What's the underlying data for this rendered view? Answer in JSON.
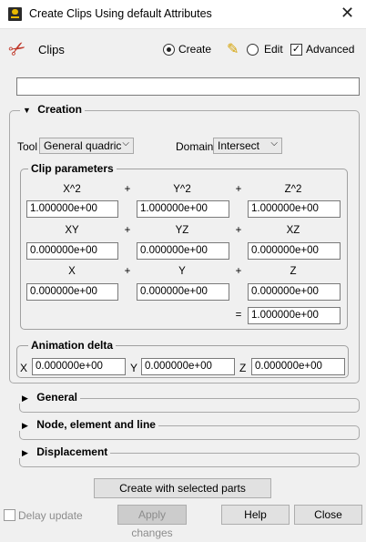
{
  "window": {
    "title": "Create Clips Using default Attributes"
  },
  "header": {
    "section_label": "Clips",
    "mode_create": "Create",
    "mode_edit": "Edit",
    "advanced": "Advanced",
    "selected_mode": "Create",
    "advanced_checked": true
  },
  "filter": {
    "value": ""
  },
  "creation": {
    "title": "Creation",
    "tool_label": "Tool",
    "tool_value": "General quadric",
    "domain_label": "Domain",
    "domain_value": "Intersect",
    "clip_parameters": {
      "title": "Clip parameters",
      "plus": "+",
      "equals": "=",
      "row1": {
        "labels": [
          "X^2",
          "Y^2",
          "Z^2"
        ],
        "values": [
          "1.000000e+00",
          "1.000000e+00",
          "1.000000e+00"
        ]
      },
      "row2": {
        "labels": [
          "XY",
          "YZ",
          "XZ"
        ],
        "values": [
          "0.000000e+00",
          "0.000000e+00",
          "0.000000e+00"
        ]
      },
      "row3": {
        "labels": [
          "X",
          "Y",
          "Z"
        ],
        "values": [
          "0.000000e+00",
          "0.000000e+00",
          "0.000000e+00"
        ]
      },
      "constant": "1.000000e+00"
    },
    "animation_delta": {
      "title": "Animation delta",
      "x_label": "X",
      "x_value": "0.000000e+00",
      "y_label": "Y",
      "y_value": "0.000000e+00",
      "z_label": "Z",
      "z_value": "0.000000e+00"
    }
  },
  "sections": {
    "general": "General",
    "node_element_line": "Node, element and line",
    "displacement": "Displacement"
  },
  "buttons": {
    "create_selected": "Create with selected parts",
    "delay_update": "Delay update",
    "apply_changes": "Apply changes",
    "help": "Help",
    "close": "Close"
  }
}
